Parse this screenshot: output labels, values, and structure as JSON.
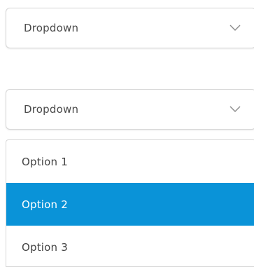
{
  "dropdown_closed": {
    "label": "Dropdown",
    "icon": "chevron-down-icon"
  },
  "dropdown_open": {
    "label": "Dropdown",
    "icon": "chevron-down-icon"
  },
  "menu": {
    "options": [
      {
        "label": "Option 1",
        "selected": false
      },
      {
        "label": "Option 2",
        "selected": true
      },
      {
        "label": "Option 3",
        "selected": false
      }
    ]
  },
  "colors": {
    "selected_background": "#0a93d8",
    "selected_text": "#ffffff",
    "border": "#d6d6d6",
    "text": "#4a4a4a"
  }
}
